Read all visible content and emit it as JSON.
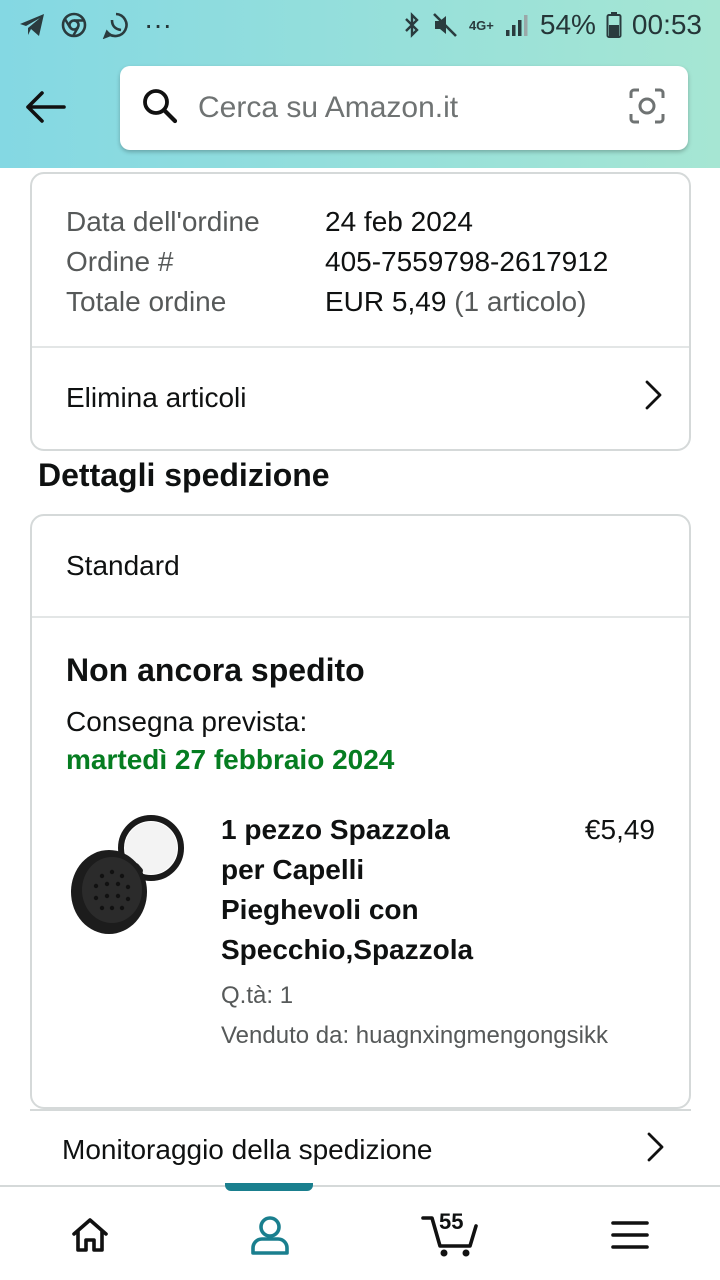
{
  "status_bar": {
    "battery_percent": "54%",
    "time": "00:53",
    "network": "4G+",
    "more_indicator": "···"
  },
  "header": {
    "search_placeholder": "Cerca su Amazon.it"
  },
  "order": {
    "rows": [
      {
        "key": "Data dell'ordine",
        "value": "24 feb 2024"
      },
      {
        "key": "Ordine #",
        "value": "405-7559798-2617912"
      },
      {
        "key": "Totale ordine",
        "value": "EUR 5,49",
        "extra": "(1 articolo)"
      }
    ],
    "delete_items_label": "Elimina articoli"
  },
  "shipping": {
    "section_title": "Dettagli spedizione",
    "method": "Standard",
    "status": "Non ancora spedito",
    "delivery_label": "Consegna prevista:",
    "delivery_date": "martedì 27 febbraio 2024",
    "item": {
      "title": "1 pezzo Spazzola per Capelli Pieghevoli con Specchio,Spazzola",
      "price": "€5,49",
      "quantity": "Q.tà: 1",
      "seller": "Venduto da: huagnxingmengongsikk"
    },
    "tracking_label": "Monitoraggio della spedizione"
  },
  "bottom_nav": {
    "items": [
      "home-icon",
      "account-icon",
      "cart-icon",
      "menu-icon"
    ],
    "active": "account-icon",
    "cart_count": "55",
    "accent_color": "#1a7f8e"
  },
  "colors": {
    "header_gradient_start": "#84d8e3",
    "header_gradient_end": "#a6e6d3",
    "delivery_green": "#067d21"
  }
}
